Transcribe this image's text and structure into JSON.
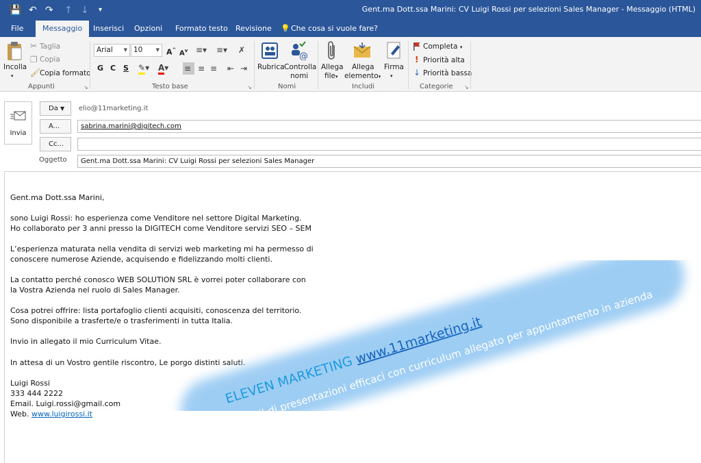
{
  "window": {
    "title": "Gent.ma Dott.ssa Marini: CV Luigi Rossi per selezioni Sales Manager  -  Messaggio (HTML)"
  },
  "tabs": [
    {
      "label": "File"
    },
    {
      "label": "Messaggio"
    },
    {
      "label": "Inserisci"
    },
    {
      "label": "Opzioni"
    },
    {
      "label": "Formato testo"
    },
    {
      "label": "Revisione"
    },
    {
      "label": "Che cosa si vuole fare?"
    }
  ],
  "ribbon": {
    "appunti": {
      "incolla": "Incolla",
      "taglia": "Taglia",
      "copia": "Copia",
      "copia_formato": "Copia formato",
      "label": "Appunti"
    },
    "testo_base": {
      "font": "Arial",
      "size": "10",
      "bold": "G",
      "italic": "C",
      "underline": "S",
      "label": "Testo base"
    },
    "nomi": {
      "rubrica": "Rubrica",
      "controlla_1": "Controlla",
      "controlla_2": "nomi",
      "label": "Nomi"
    },
    "includi": {
      "allega_file_1": "Allega",
      "allega_file_2": "file",
      "allega_elem_1": "Allega",
      "allega_elem_2": "elemento",
      "firma": "Firma",
      "label": "Includi"
    },
    "categorie": {
      "completa": "Completa",
      "priorita_alta": "Priorità alta",
      "priorita_bassa": "Priorità bassa",
      "label": "Categorie"
    },
    "colors": {
      "accent": "#2b579a",
      "flag": "#c0392b",
      "priority_high": "#d83b01",
      "priority_low": "#2b6cc4"
    }
  },
  "header": {
    "send": "Invia",
    "from_button": "Da",
    "from_value": "elio@11marketing.it",
    "to_button": "A...",
    "to_value": "sabrina.marini@digitech.com",
    "cc_button": "Cc...",
    "cc_value": "",
    "subject_label": "Oggetto",
    "subject_value": "Gent.ma Dott.ssa Marini: CV Luigi Rossi per selezioni Sales Manager"
  },
  "body": {
    "greeting": "Gent.ma Dott.ssa Marini,",
    "p1_l1": "sono Luigi Rossi: ho esperienza come Venditore nel settore Digital Marketing.",
    "p1_l2": "Ho collaborato per 3 anni presso la DIGITECH come Venditore servizi SEO – SEM",
    "p2_l1": "L’esperienza maturata nella vendita di servizi web marketing mi ha permesso di",
    "p2_l2": "conoscere numerose Aziende, acquisendo e fidelizzando molti clienti.",
    "p3_l1": "La contatto perché conosco WEB SOLUTION SRL è vorrei poter collaborare con",
    "p3_l2": "la Vostra Azienda nel ruolo di Sales Manager.",
    "p4_l1": "Cosa potrei offrire: lista portafoglio clienti acquisiti, conoscenza del territorio.",
    "p4_l2": "Sono disponibile a trasferte/e o trasferimenti in tutta Italia.",
    "p5": "Invio in allegato il mio Curriculum Vitae.",
    "p6": "In attesa di un Vostro gentile riscontro, Le porgo distinti saluti.",
    "sig_name": "Luigi Rossi",
    "sig_phone": "333 444 2222",
    "sig_email": "Email. Luigi.rossi@gmail.com",
    "sig_web_prefix": "Web. ",
    "sig_web_link": "www.luigirossi.it"
  },
  "watermark": {
    "brand": "ELEVEN MARKETING ",
    "url": "www.11marketing.it",
    "tagline": "Inviare email di presentazioni  efficaci con curriculum allegato per appuntamento  in azienda"
  }
}
